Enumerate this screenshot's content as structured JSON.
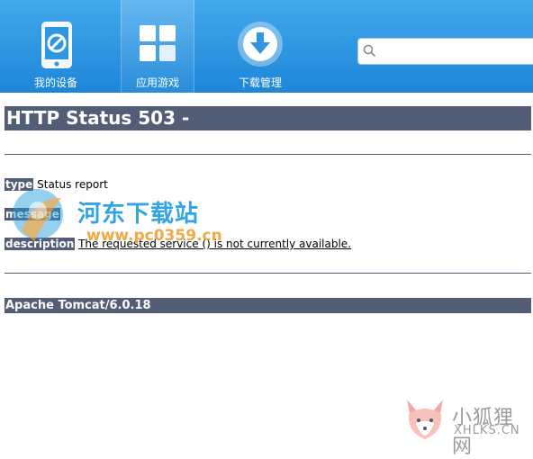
{
  "toolbar": {
    "items": [
      {
        "label": "我的设备",
        "icon": "phone-icon"
      },
      {
        "label": "应用游戏",
        "icon": "apps-grid-icon"
      },
      {
        "label": "下载管理",
        "icon": "download-icon"
      }
    ],
    "search": {
      "placeholder": "",
      "value": ""
    }
  },
  "error_page": {
    "title": "HTTP Status 503 -",
    "type_label": "type",
    "type_value": "Status report",
    "message_label": "message",
    "message_value": "",
    "description_label": "description",
    "description_value": "The requested service () is not currently available.",
    "footer": "Apache Tomcat/6.0.18"
  },
  "watermarks": {
    "primary_text": "河东下载站",
    "primary_url": "www.pc0359.cn",
    "secondary_text": "小狐狸网",
    "secondary_sub": "XHLKS.CN"
  },
  "colors": {
    "toolbar_top": "#43a8ec",
    "toolbar_bottom": "#1d86d8",
    "tomcat_bar": "#525d76"
  }
}
